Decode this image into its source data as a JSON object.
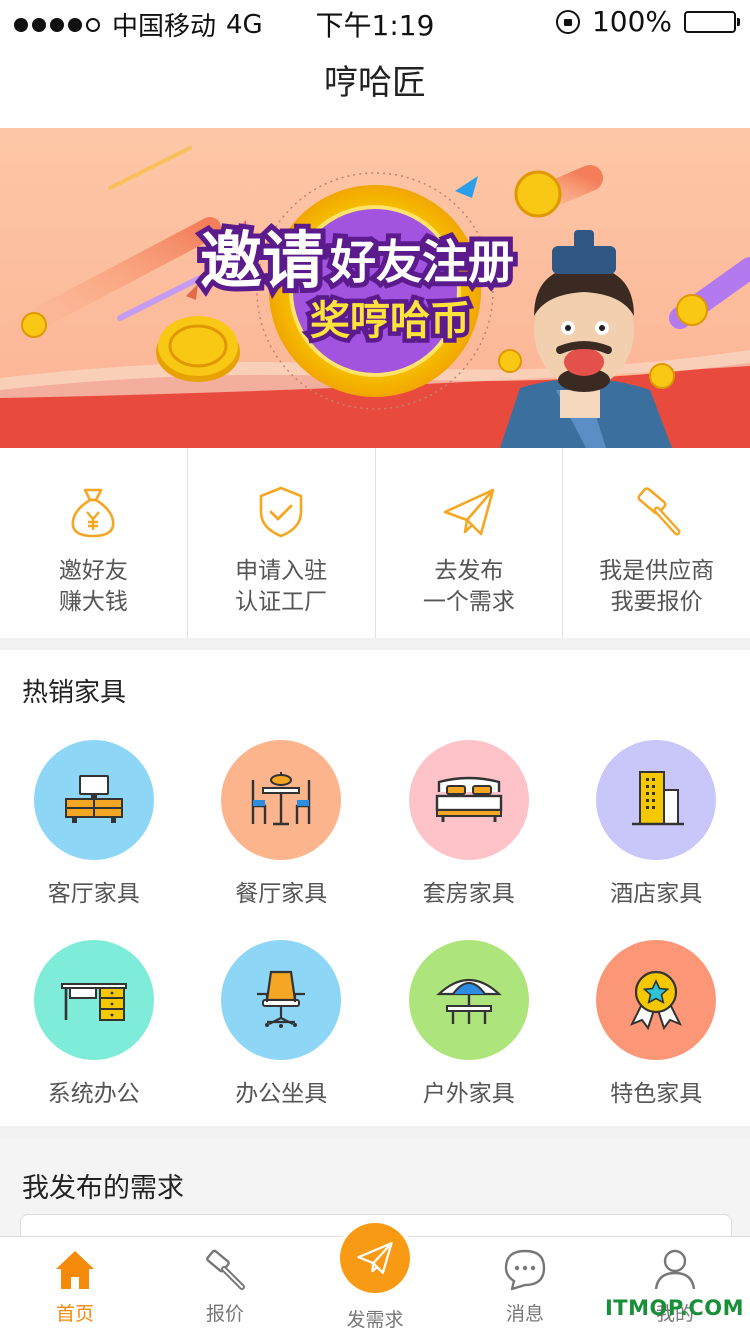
{
  "status_bar": {
    "carrier": "中国移动",
    "network": "4G",
    "time": "下午1:19",
    "battery": "100%",
    "signal_bars": 4
  },
  "nav": {
    "title": "哼哈匠"
  },
  "banner": {
    "headline_part1": "邀请",
    "headline_part2": "好友注册",
    "subline": "奖哼哈币"
  },
  "quick_actions": [
    {
      "line1": "邀好友",
      "line2": "赚大钱",
      "icon": "money-bag-icon"
    },
    {
      "line1": "申请入驻",
      "line2": "认证工厂",
      "icon": "shield-check-icon"
    },
    {
      "line1": "去发布",
      "line2": "一个需求",
      "icon": "paper-plane-icon"
    },
    {
      "line1": "我是供应商",
      "line2": "我要报价",
      "icon": "hammer-icon"
    }
  ],
  "hot_section": {
    "title": "热销家具",
    "items": [
      {
        "label": "客厅家具",
        "color": "#8dd6f6",
        "icon": "tv-cabinet-icon"
      },
      {
        "label": "餐厅家具",
        "color": "#fbb48c",
        "icon": "dining-table-icon"
      },
      {
        "label": "套房家具",
        "color": "#fdc3c8",
        "icon": "bed-icon"
      },
      {
        "label": "酒店家具",
        "color": "#c9c7f9",
        "icon": "hotel-building-icon"
      },
      {
        "label": "系统办公",
        "color": "#7eecd8",
        "icon": "office-desk-icon"
      },
      {
        "label": "办公坐具",
        "color": "#8dd6f6",
        "icon": "office-chair-icon"
      },
      {
        "label": "户外家具",
        "color": "#aee47c",
        "icon": "parasol-table-icon"
      },
      {
        "label": "特色家具",
        "color": "#fb9776",
        "icon": "award-badge-icon"
      }
    ]
  },
  "demands": {
    "title": "我发布的需求"
  },
  "tabbar": [
    {
      "label": "首页",
      "icon": "home-icon",
      "active": true
    },
    {
      "label": "报价",
      "icon": "hammer-icon",
      "active": false
    },
    {
      "label": "发需求",
      "icon": "paper-plane-icon",
      "active": false
    },
    {
      "label": "消息",
      "icon": "chat-bubble-icon",
      "active": false
    },
    {
      "label": "我的",
      "icon": "user-icon",
      "active": false
    }
  ],
  "watermark": "ITMOP.COM",
  "colors": {
    "accent": "#f5a623",
    "tab_active": "#f5890a",
    "divider": "#e2e2e2"
  }
}
